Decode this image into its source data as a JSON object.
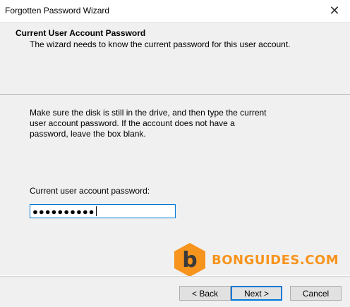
{
  "window": {
    "title": "Forgotten Password Wizard",
    "close_glyph": "✕"
  },
  "header": {
    "title": "Current User Account Password",
    "subtitle": "The wizard needs to know the current password for this user account."
  },
  "content": {
    "instructions": "Make sure the disk is still in the drive, and then type the current user account password. If the account does not have a password, leave the box blank.",
    "password_label": "Current user account password:",
    "password_masked": "●●●●●●●●●●"
  },
  "watermark": {
    "text": "BONGUIDES.COM",
    "logo_letter": "b",
    "color": "#f7941d"
  },
  "buttons": {
    "back": "< Back",
    "next": "Next >",
    "cancel": "Cancel"
  },
  "colors": {
    "accent": "#0078d7",
    "panel": "#f0f0f0"
  }
}
